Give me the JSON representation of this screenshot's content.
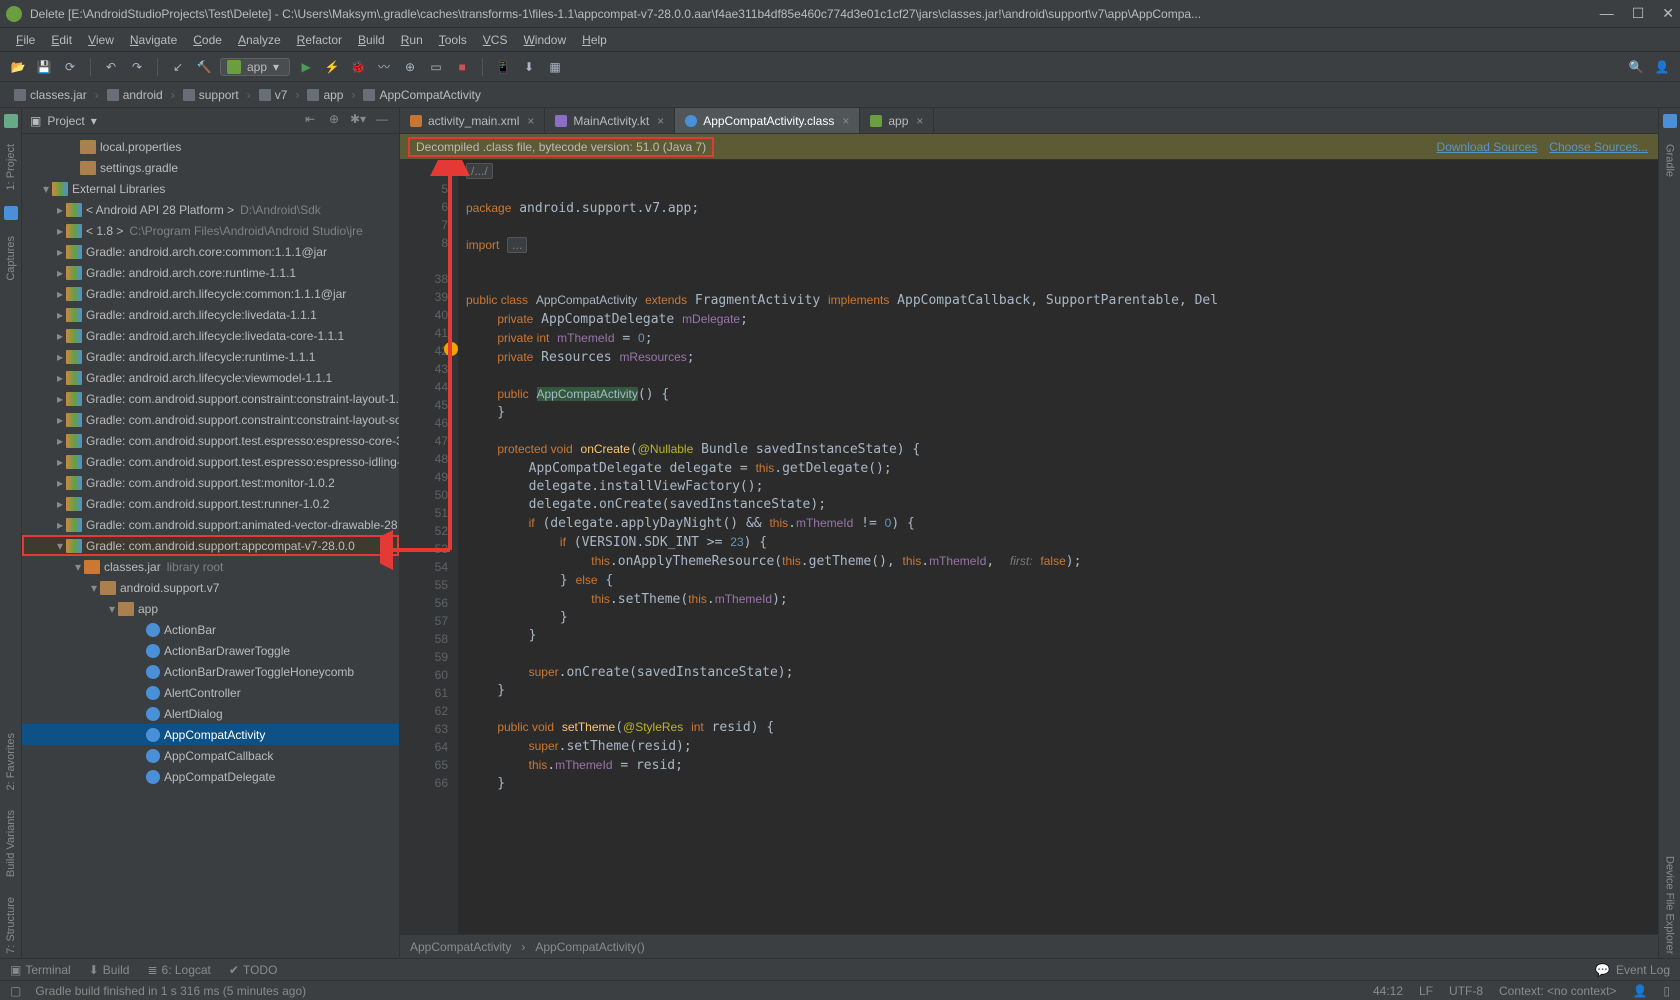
{
  "titlebar": {
    "text": "Delete [E:\\AndroidStudioProjects\\Test\\Delete] - C:\\Users\\Maksym\\.gradle\\caches\\transforms-1\\files-1.1\\appcompat-v7-28.0.0.aar\\f4ae311b4df85e460c774d3e01c1cf27\\jars\\classes.jar!\\android\\support\\v7\\app\\AppCompa..."
  },
  "menu": [
    "File",
    "Edit",
    "View",
    "Navigate",
    "Code",
    "Analyze",
    "Refactor",
    "Build",
    "Run",
    "Tools",
    "VCS",
    "Window",
    "Help"
  ],
  "toolbar_config": {
    "label": "app"
  },
  "breadcrumbs": [
    "classes.jar",
    "android",
    "support",
    "v7",
    "app",
    "AppCompatActivity"
  ],
  "project_panel": {
    "title": "Project"
  },
  "tree": {
    "top": [
      {
        "label": "local.properties",
        "icon": "file",
        "indent": 46
      },
      {
        "label": "settings.gradle",
        "icon": "file",
        "indent": 46
      }
    ],
    "ext_lib_label": "External Libraries",
    "libs": [
      {
        "label": "< Android API 28 Platform >",
        "gray": "D:\\Android\\Sdk"
      },
      {
        "label": "< 1.8 >",
        "gray": "C:\\Program Files\\Android\\Android Studio\\jre"
      },
      {
        "label": "Gradle: android.arch.core:common:1.1.1@jar"
      },
      {
        "label": "Gradle: android.arch.core:runtime-1.1.1"
      },
      {
        "label": "Gradle: android.arch.lifecycle:common:1.1.1@jar"
      },
      {
        "label": "Gradle: android.arch.lifecycle:livedata-1.1.1"
      },
      {
        "label": "Gradle: android.arch.lifecycle:livedata-core-1.1.1"
      },
      {
        "label": "Gradle: android.arch.lifecycle:runtime-1.1.1"
      },
      {
        "label": "Gradle: android.arch.lifecycle:viewmodel-1.1.1"
      },
      {
        "label": "Gradle: com.android.support.constraint:constraint-layout-1."
      },
      {
        "label": "Gradle: com.android.support.constraint:constraint-layout-so"
      },
      {
        "label": "Gradle: com.android.support.test.espresso:espresso-core-3."
      },
      {
        "label": "Gradle: com.android.support.test.espresso:espresso-idling-"
      },
      {
        "label": "Gradle: com.android.support.test:monitor-1.0.2"
      },
      {
        "label": "Gradle: com.android.support.test:runner-1.0.2"
      },
      {
        "label": "Gradle: com.android.support:animated-vector-drawable-28"
      },
      {
        "label": "Gradle: com.android.support:appcompat-v7-28.0.0",
        "highlight": true,
        "expanded": true
      }
    ],
    "appcompat": {
      "jar": "classes.jar",
      "jar_gray": "library root",
      "pkg": "android.support.v7",
      "app": "app",
      "classes": [
        "ActionBar",
        "ActionBarDrawerToggle",
        "ActionBarDrawerToggleHoneycomb",
        "AlertController",
        "AlertDialog",
        "AppCompatActivity",
        "AppCompatCallback",
        "AppCompatDelegate"
      ]
    }
  },
  "tabs": [
    {
      "label": "activity_main.xml",
      "kind": "xml"
    },
    {
      "label": "MainActivity.kt",
      "kind": "kt"
    },
    {
      "label": "AppCompatActivity.class",
      "kind": "cls",
      "active": true
    },
    {
      "label": "app",
      "kind": "andr"
    }
  ],
  "banner": {
    "text": "Decompiled .class file, bytecode version: 51.0 (Java 7)",
    "links": [
      "Download Sources",
      "Choose Sources..."
    ]
  },
  "code": {
    "lines": [
      4,
      5,
      6,
      7,
      8,
      "",
      38,
      39,
      40,
      41,
      42,
      43,
      44,
      45,
      46,
      47,
      48,
      49,
      50,
      51,
      52,
      53,
      54,
      55,
      56,
      57,
      58,
      59,
      60,
      61,
      62,
      63,
      64,
      65,
      66
    ]
  },
  "editor_crumb": [
    "AppCompatActivity",
    "AppCompatActivity()"
  ],
  "left_tools": [
    "1: Project",
    "Captures"
  ],
  "left_tools2": [
    "2: Favorites",
    "Build Variants",
    "7: Structure"
  ],
  "right_tools": [
    "Gradle",
    "Device File Explorer"
  ],
  "bottom_tools": {
    "items": [
      "Terminal",
      "Build",
      "6: Logcat",
      "TODO"
    ],
    "right": "Event Log"
  },
  "status": {
    "text": "Gradle build finished in 1 s 316 ms (5 minutes ago)",
    "pos": "44:12",
    "eol": "LF",
    "enc": "UTF-8",
    "context": "Context: <no context>"
  }
}
